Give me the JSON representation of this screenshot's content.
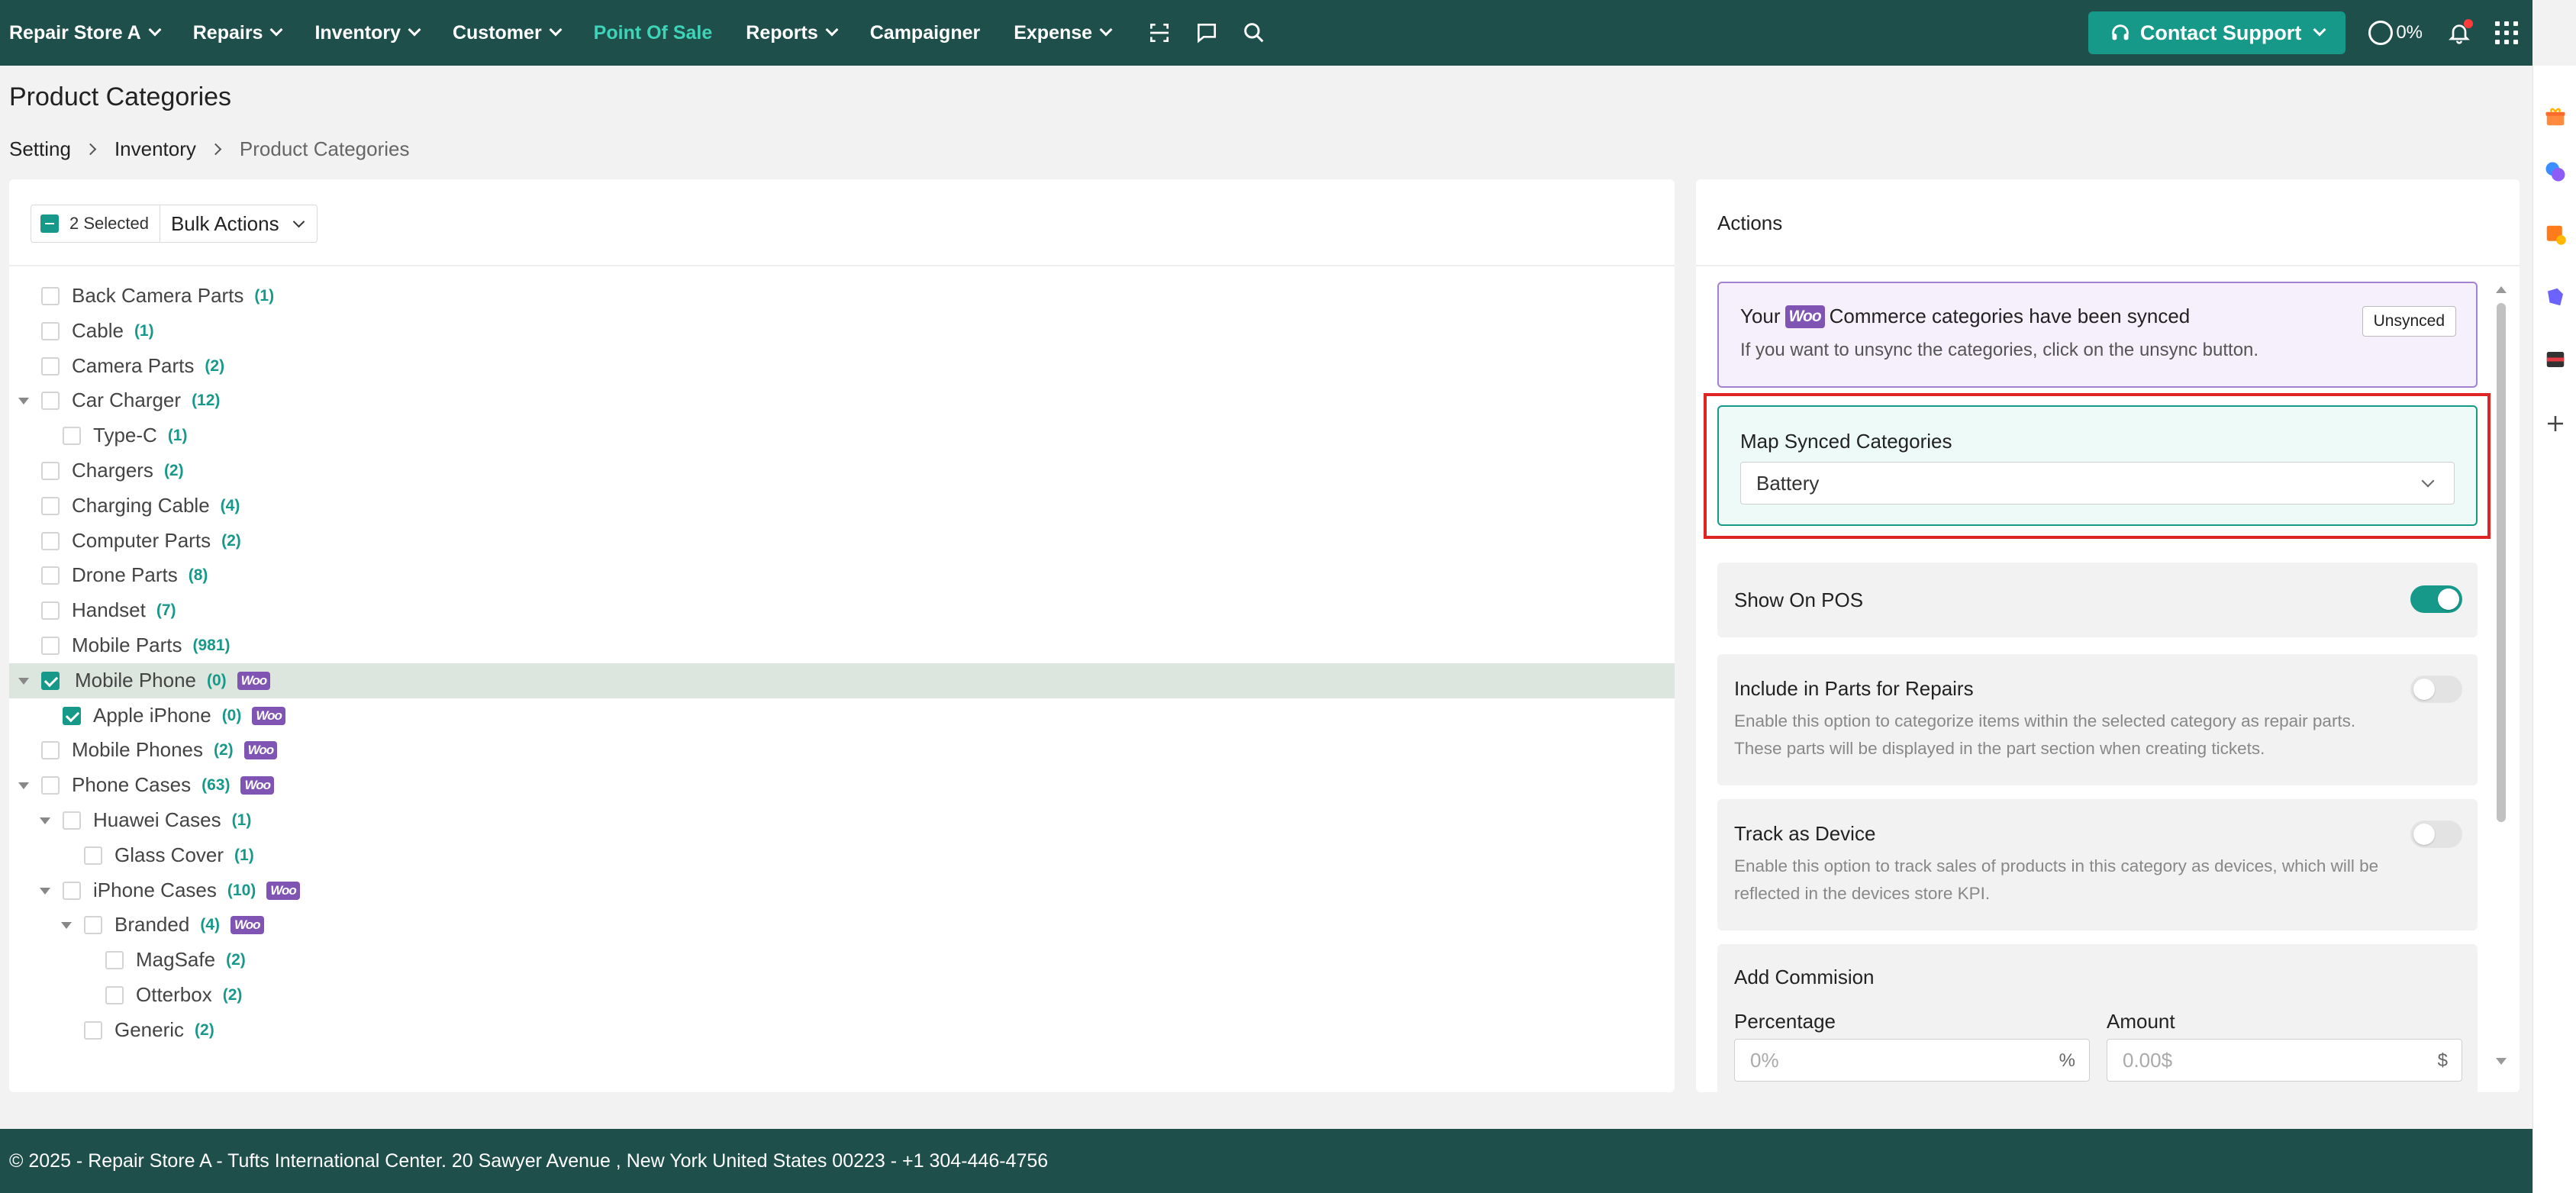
{
  "nav": {
    "items": [
      {
        "label": "Repair Store A",
        "chevron": true,
        "active": false
      },
      {
        "label": "Repairs",
        "chevron": true,
        "active": false
      },
      {
        "label": "Inventory",
        "chevron": true,
        "active": false
      },
      {
        "label": "Customer",
        "chevron": true,
        "active": false
      },
      {
        "label": "Point Of Sale",
        "chevron": false,
        "active": true
      },
      {
        "label": "Reports",
        "chevron": true,
        "active": false
      },
      {
        "label": "Campaigner",
        "chevron": false,
        "active": false
      },
      {
        "label": "Expense",
        "chevron": true,
        "active": false
      }
    ],
    "icons": [
      "scan-icon",
      "chat-icon",
      "search-icon"
    ],
    "support_label": "Contact Support",
    "progress_label": "0%",
    "colors": {
      "bar": "#1f4f4b",
      "accent": "#17998a",
      "active": "#3fd3b8",
      "woo": "#7f54b3",
      "highlight": "#e02424"
    }
  },
  "page": {
    "title": "Product Categories",
    "breadcrumb": [
      "Setting",
      "Inventory",
      "Product Categories"
    ]
  },
  "toolbar": {
    "selected_label": "2 Selected",
    "bulk_label": "Bulk Actions"
  },
  "tree": [
    {
      "name": "Back Camera Parts",
      "count": "(1)",
      "depth": 0,
      "caret": false,
      "checked": false,
      "woo": false
    },
    {
      "name": "Cable",
      "count": "(1)",
      "depth": 0,
      "caret": false,
      "checked": false,
      "woo": false
    },
    {
      "name": "Camera Parts",
      "count": "(2)",
      "depth": 0,
      "caret": false,
      "checked": false,
      "woo": false
    },
    {
      "name": "Car Charger",
      "count": "(12)",
      "depth": 0,
      "caret": true,
      "checked": false,
      "woo": false
    },
    {
      "name": "Type-C",
      "count": "(1)",
      "depth": 1,
      "caret": false,
      "checked": false,
      "woo": false
    },
    {
      "name": "Chargers",
      "count": "(2)",
      "depth": 0,
      "caret": false,
      "checked": false,
      "woo": false
    },
    {
      "name": "Charging Cable",
      "count": "(4)",
      "depth": 0,
      "caret": false,
      "checked": false,
      "woo": false
    },
    {
      "name": "Computer Parts",
      "count": "(2)",
      "depth": 0,
      "caret": false,
      "checked": false,
      "woo": false
    },
    {
      "name": "Drone Parts",
      "count": "(8)",
      "depth": 0,
      "caret": false,
      "checked": false,
      "woo": false
    },
    {
      "name": "Handset",
      "count": "(7)",
      "depth": 0,
      "caret": false,
      "checked": false,
      "woo": false
    },
    {
      "name": "Mobile Parts",
      "count": "(981)",
      "depth": 0,
      "caret": false,
      "checked": false,
      "woo": false
    },
    {
      "name": "Mobile Phone",
      "count": "(0)",
      "depth": 0,
      "caret": true,
      "checked": true,
      "woo": true,
      "selected": true
    },
    {
      "name": "Apple iPhone",
      "count": "(0)",
      "depth": 1,
      "caret": false,
      "checked": true,
      "woo": true
    },
    {
      "name": "Mobile Phones",
      "count": "(2)",
      "depth": 0,
      "caret": false,
      "checked": false,
      "woo": true
    },
    {
      "name": "Phone Cases",
      "count": "(63)",
      "depth": 0,
      "caret": true,
      "checked": false,
      "woo": true
    },
    {
      "name": "Huawei Cases",
      "count": "(1)",
      "depth": 1,
      "caret": true,
      "checked": false,
      "woo": false
    },
    {
      "name": "Glass Cover",
      "count": "(1)",
      "depth": 2,
      "caret": false,
      "checked": false,
      "woo": false
    },
    {
      "name": "iPhone Cases",
      "count": "(10)",
      "depth": 1,
      "caret": true,
      "checked": false,
      "woo": true
    },
    {
      "name": "Branded",
      "count": "(4)",
      "depth": 2,
      "caret": true,
      "checked": false,
      "woo": true
    },
    {
      "name": "MagSafe",
      "count": "(2)",
      "depth": 3,
      "caret": false,
      "checked": false,
      "woo": false
    },
    {
      "name": "Otterbox",
      "count": "(2)",
      "depth": 3,
      "caret": false,
      "checked": false,
      "woo": false
    },
    {
      "name": "Generic",
      "count": "(2)",
      "depth": 2,
      "caret": false,
      "checked": false,
      "woo": false
    }
  ],
  "woo_badge": "Woo",
  "actions": {
    "title": "Actions",
    "sync": {
      "prefix": "Your",
      "badge": "Woo",
      "suffix": "Commerce categories have been synced",
      "subtitle": "If you want to unsync the categories, click on the unsync button.",
      "unsync_label": "Unsynced"
    },
    "map": {
      "label": "Map Synced Categories",
      "value": "Battery"
    },
    "show_on_pos": {
      "label": "Show On POS",
      "enabled": true
    },
    "include_parts": {
      "label": "Include in Parts for Repairs",
      "enabled": false,
      "description": "Enable this option to categorize items within the selected category as repair parts. These parts will be displayed in the part section when creating tickets."
    },
    "track_device": {
      "label": "Track as Device",
      "enabled": false,
      "description": "Enable this option to track sales of products in this category as devices, which will be reflected in the devices store KPI."
    },
    "commission": {
      "title": "Add Commision",
      "percentage_label": "Percentage",
      "percentage_placeholder": "0%",
      "percentage_suffix": "%",
      "amount_label": "Amount",
      "amount_placeholder": "0.00$",
      "amount_suffix": "$"
    }
  },
  "footer": {
    "text": "© 2025 - Repair Store A - Tufts International Center. 20 Sawyer Avenue , New York United States 00223 - +1 304-446-4756"
  }
}
